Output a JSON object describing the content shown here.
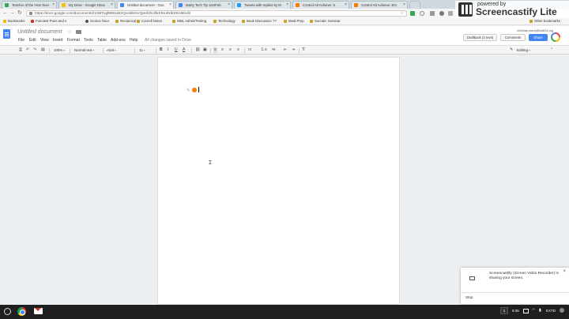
{
  "tabs": [
    {
      "label": "Teacher of the Year Surv",
      "color": "#34a853"
    },
    {
      "label": "My Drive - Google Drive",
      "color": "#fbbc05"
    },
    {
      "label": "Untitled document - Goo",
      "color": "#4285f4"
    },
    {
      "label": "Marty Tech Tip Jan/Feb",
      "color": "#4285f4"
    },
    {
      "label": "Tweets with replies by M",
      "color": "#1da1f2"
    },
    {
      "label": "Control Alt Achieve: 5 ",
      "color": "#f57c00"
    },
    {
      "label": "Control Alt Achieve: Em",
      "color": "#f57c00"
    }
  ],
  "omnibox": {
    "url": "https://docs.google.com/document/d/1OBTugf8B0LBtXQv4d6zsVQaHl2hzZlkKtHuRdk20tAM/edit"
  },
  "bookmarks": [
    "Bookmarks",
    "Funniest Puns and s",
    "Genius Hour",
    "Reciprocal",
    "Cornell Notes",
    "WBL Admin/Testing",
    "Technology",
    "Book Discussion ??",
    "Meal Prep",
    "Socratic Seminar"
  ],
  "other_bookmarks": "Other bookmarks",
  "watermark": {
    "powered_by": "powered by",
    "brand": "Screencastify Lite"
  },
  "docs": {
    "title": "Untitled document",
    "menus": [
      "File",
      "Edit",
      "View",
      "Insert",
      "Format",
      "Tools",
      "Table",
      "Add-ons",
      "Help"
    ],
    "saved_status": "All changes saved in Drive",
    "user_email": "nicholas.marty@isd624.org",
    "draft_button": "Draftback (3 revs)",
    "comments_button": "Comments",
    "share_button": "Share"
  },
  "toolbar": {
    "zoom": "100%",
    "style": "Normal text",
    "font": "Arial",
    "size": "11",
    "mode": "Editing"
  },
  "document": {
    "content_glyph": "🐁"
  },
  "notification": {
    "message": "Screencastify (Screen Video Recorder) is sharing your screen.",
    "stop_label": "Stop"
  },
  "taskbar": {
    "notification_count": "1",
    "time": "8:36",
    "tray_label": "EXTD"
  }
}
